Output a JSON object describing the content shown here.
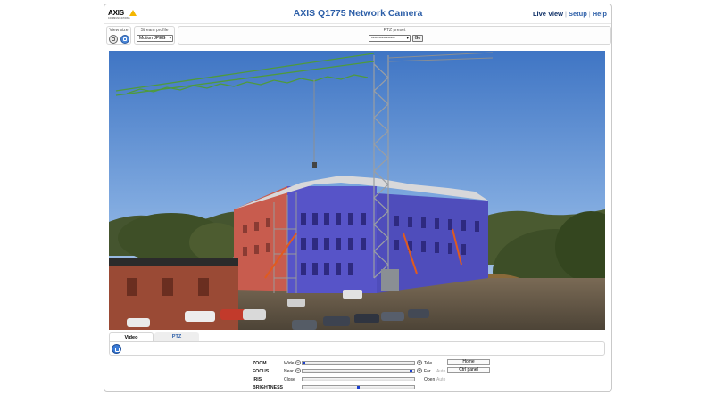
{
  "header": {
    "logo_text": "AXIS",
    "logo_subtext": "COMMUNICATIONS",
    "title": "AXIS Q1775 Network Camera",
    "nav": [
      {
        "label": "Live View"
      },
      {
        "label": "Setup"
      },
      {
        "label": "Help"
      }
    ],
    "nav_separator": "|"
  },
  "toolbar": {
    "view_size_label": "View size",
    "stream_profile_label": "Stream profile",
    "stream_profile_value": "Motion JPEG",
    "ptz_preset_label": "PTZ preset",
    "ptz_preset_value": "----------------",
    "go_label": "Go"
  },
  "video": {
    "description_icon": "camera-feed"
  },
  "tabs": [
    {
      "label": "Video"
    },
    {
      "label": "PTZ"
    }
  ],
  "controls": {
    "zoom": {
      "name": "ZOOM",
      "low": "Wide",
      "high": "Tele",
      "button": "Home",
      "level": 0.0
    },
    "focus": {
      "name": "FOCUS",
      "low": "Near",
      "high": "Far",
      "auto": "Auto",
      "button": "Ctrl panel",
      "level": 0.98
    },
    "iris": {
      "name": "IRIS",
      "low": "Close",
      "high": "Open",
      "auto": "Auto"
    },
    "brightness": {
      "name": "BRIGHTNESS",
      "level": 0.5
    }
  },
  "colors": {
    "accent": "#2d5fa8",
    "logo_yellow": "#f4b600"
  }
}
